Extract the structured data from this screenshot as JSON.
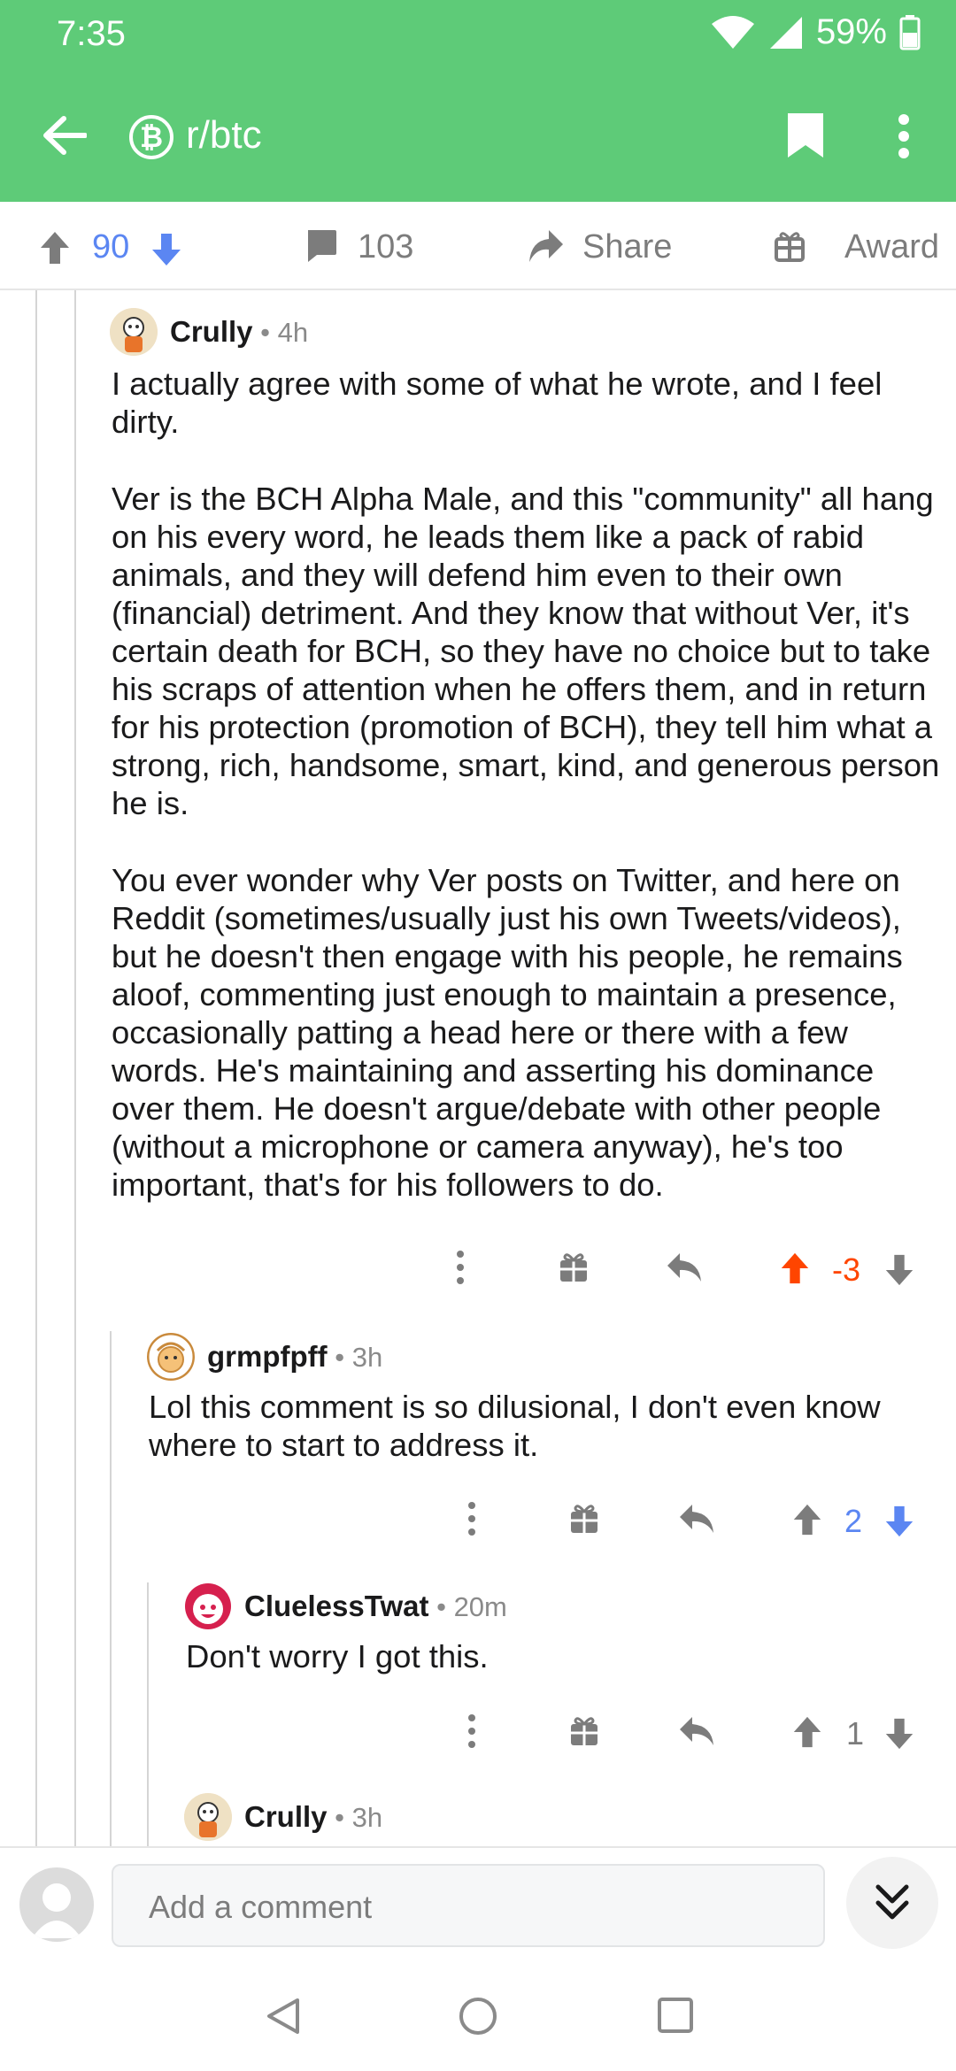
{
  "status_bar": {
    "time": "7:35",
    "battery": "59%"
  },
  "header": {
    "subreddit": "r/btc",
    "badge_symbol": "₿",
    "accent_color": "#5ecb78",
    "icons": [
      "back-arrow-icon",
      "bitcoin-icon",
      "bookmark-icon",
      "more-vert-icon"
    ]
  },
  "post_actions": {
    "upvotes": "90",
    "comments": "103",
    "share_label": "Share",
    "award_label": "Award"
  },
  "comments": [
    {
      "author": "Crully",
      "age": "4h",
      "body": [
        "I actually agree with some of what he wrote, and I feel dirty.",
        "Ver is the BCH Alpha Male, and this \"community\" all hang on his every word, he leads them like a pack of rabid animals, and they will defend him even to their own (financial) detriment.  And they know that without Ver, it's certain death for BCH, so they have no choice but to take his scraps of attention when he offers them, and in return for his protection (promotion of BCH), they tell him what a strong, rich, handsome, smart, kind, and generous person he is.",
        "You ever wonder why Ver posts on Twitter, and here on Reddit (sometimes/usually just his own Tweets/videos), but he doesn't then engage with his people, he remains aloof, commenting just enough to maintain a presence, occasionally patting a head here or there with a few words. He's maintaining and asserting his dominance over them.  He doesn't argue/debate with other people (without a microphone or camera anyway), he's too important, that's for his followers to do."
      ],
      "score": "-3",
      "vote_state": "upvoted"
    },
    {
      "author": "grmpfpff",
      "age": "3h",
      "body": [
        "Lol this comment is so dilusional, I don't even know where to start to address it."
      ],
      "score": "2",
      "vote_state": "downvoted"
    },
    {
      "author": "CluelessTwat",
      "age": "20m",
      "body": [
        "Don't worry I got this."
      ],
      "score": "1",
      "vote_state": "none"
    },
    {
      "author": "Crully",
      "age": "3h"
    }
  ],
  "colors": {
    "upvote": "#ff4500",
    "downvote": "#5b86f2",
    "neutral": "#7c7c7c"
  },
  "comment_bar": {
    "placeholder": "Add a comment"
  }
}
